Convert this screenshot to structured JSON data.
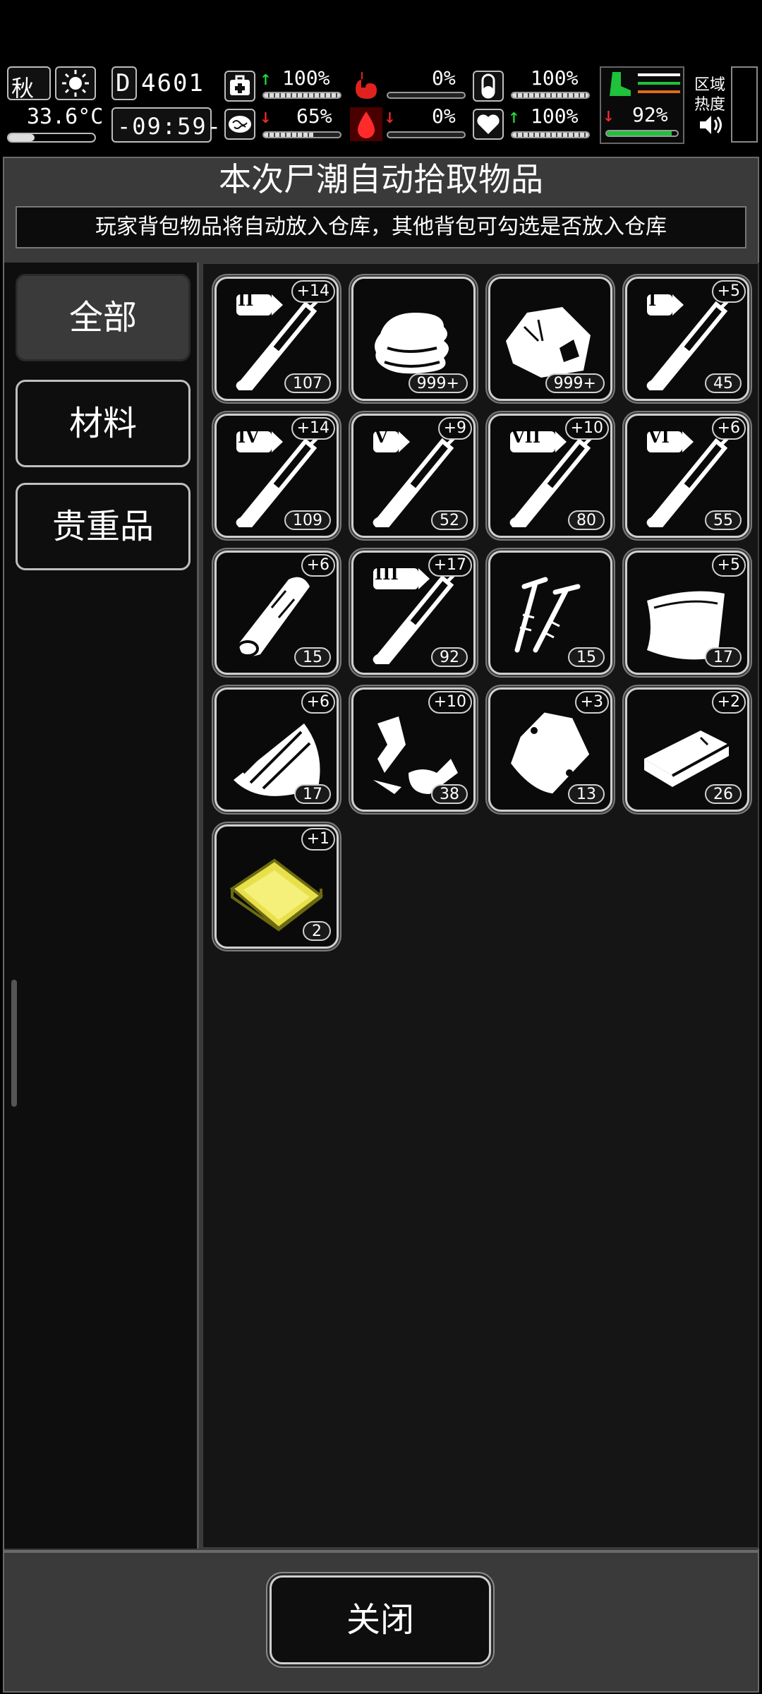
{
  "status": {
    "season": "秋",
    "temperature": "33.6°C",
    "day_counter": "4601",
    "day_prefix": "D",
    "clock": "-09:59-",
    "health_pct": "100%",
    "hunger_pct": "0%",
    "thirst_pct": "100%",
    "brain_pct": "65%",
    "blood_pct": "0%",
    "heart_pct": "100%",
    "stamina_pct": "92%",
    "area_heat_label_1": "区域",
    "area_heat_label_2": "热度"
  },
  "dialog": {
    "title": "本次尸潮自动拾取物品",
    "subtitle": "玩家背包物品将自动放入仓库，其他背包可勾选是否放入仓库",
    "close_label": "关闭"
  },
  "categories": [
    {
      "label": "全部",
      "active": true
    },
    {
      "label": "材料",
      "active": false
    },
    {
      "label": "贵重品",
      "active": false
    }
  ],
  "items": [
    {
      "icon": "syringe-tier-2-icon",
      "tier": "II",
      "bonus": "+14",
      "count": "107"
    },
    {
      "icon": "cloth-icon",
      "tier": "",
      "bonus": "",
      "count": "999+"
    },
    {
      "icon": "ore-rock-icon",
      "tier": "",
      "bonus": "",
      "count": "999+"
    },
    {
      "icon": "syringe-tier-1-icon",
      "tier": "I",
      "bonus": "+5",
      "count": "45"
    },
    {
      "icon": "syringe-tier-4-icon",
      "tier": "IV",
      "bonus": "+14",
      "count": "109"
    },
    {
      "icon": "syringe-tier-5-icon",
      "tier": "V",
      "bonus": "+9",
      "count": "52"
    },
    {
      "icon": "syringe-tier-7-icon",
      "tier": "VII",
      "bonus": "+10",
      "count": "80"
    },
    {
      "icon": "syringe-tier-6-icon",
      "tier": "VI",
      "bonus": "+6",
      "count": "55"
    },
    {
      "icon": "wood-log-icon",
      "tier": "",
      "bonus": "+6",
      "count": "15"
    },
    {
      "icon": "syringe-tier-3-icon",
      "tier": "III",
      "bonus": "+17",
      "count": "92"
    },
    {
      "icon": "screws-icon",
      "tier": "",
      "bonus": "",
      "count": "15"
    },
    {
      "icon": "leather-sheet-icon",
      "tier": "",
      "bonus": "+5",
      "count": "17"
    },
    {
      "icon": "wood-planks-icon",
      "tier": "",
      "bonus": "+6",
      "count": "17"
    },
    {
      "icon": "scrap-parts-icon",
      "tier": "",
      "bonus": "+10",
      "count": "38"
    },
    {
      "icon": "pouch-bag-icon",
      "tier": "",
      "bonus": "+3",
      "count": "13"
    },
    {
      "icon": "metal-ingot-icon",
      "tier": "",
      "bonus": "+2",
      "count": "26"
    },
    {
      "icon": "gold-plate-icon",
      "tier": "",
      "bonus": "+1",
      "count": "2"
    }
  ],
  "colors": {
    "panel": "#3a3a3a",
    "grid_bg": "#151515",
    "up_arrow": "#22e03a",
    "down_arrow": "#ff2a2a",
    "gold": "#e8e04a"
  }
}
